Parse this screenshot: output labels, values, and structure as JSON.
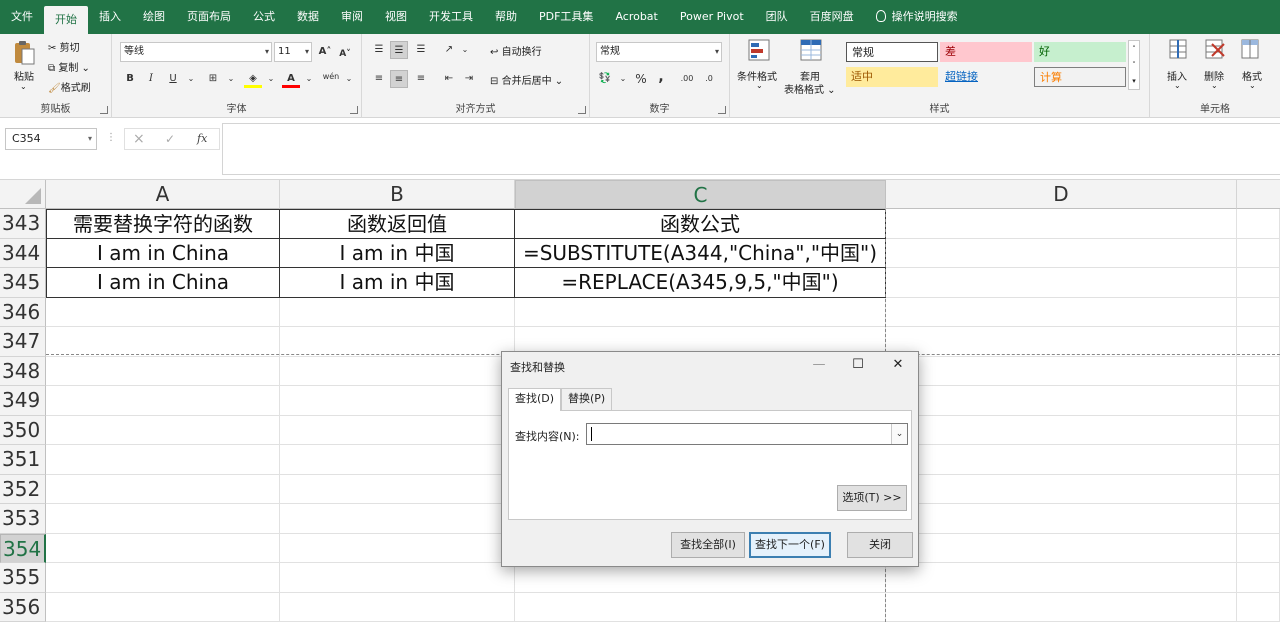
{
  "tabs": [
    "文件",
    "开始",
    "插入",
    "绘图",
    "页面布局",
    "公式",
    "数据",
    "审阅",
    "视图",
    "开发工具",
    "帮助",
    "PDF工具集",
    "Acrobat",
    "Power Pivot",
    "团队",
    "百度网盘"
  ],
  "active_tab": "开始",
  "tell_me": "操作说明搜索",
  "ribbon": {
    "clipboard": {
      "paste": "粘贴",
      "cut": "剪切",
      "copy": "复制",
      "format_painter": "格式刷",
      "label": "剪贴板"
    },
    "font": {
      "name": "等线",
      "size": "11",
      "bold": "B",
      "italic": "I",
      "underline": "U",
      "grow": "A",
      "shrink": "A",
      "font_color": "A",
      "phonetic": "wén",
      "label": "字体"
    },
    "alignment": {
      "wrap": "自动换行",
      "merge": "合并后居中",
      "label": "对齐方式"
    },
    "number": {
      "format": "常规",
      "percent": "%",
      "comma": ",",
      "inc_dec": ".00",
      "dec_dec": ".0",
      "label": "数字"
    },
    "styles": {
      "conditional": "条件格式",
      "table": "套用",
      "table2": "表格格式",
      "normal": "常规",
      "bad": "差",
      "good": "好",
      "neutral": "适中",
      "hyperlink": "超链接",
      "calc": "计算",
      "label": "样式"
    },
    "cells": {
      "insert": "插入",
      "delete": "删除",
      "format": "格式",
      "label": "单元格"
    }
  },
  "formula_bar": {
    "name_box": "C354",
    "cancel": "×",
    "enter": "✓",
    "fx": "fx"
  },
  "columns": [
    "A",
    "B",
    "C",
    "D"
  ],
  "rows": [
    {
      "num": "343",
      "cells": [
        "需要替换字符的函数",
        "函数返回值",
        "函数公式"
      ]
    },
    {
      "num": "344",
      "cells": [
        "I am in China",
        "I am in 中国",
        "=SUBSTITUTE(A344,\"China\",\"中国\")"
      ]
    },
    {
      "num": "345",
      "cells": [
        "I am in China",
        "I am in 中国",
        "=REPLACE(A345,9,5,\"中国\")"
      ]
    },
    {
      "num": "346",
      "cells": [
        "",
        "",
        ""
      ]
    },
    {
      "num": "347",
      "cells": [
        "",
        "",
        ""
      ]
    },
    {
      "num": "348",
      "cells": [
        "",
        "",
        ""
      ]
    },
    {
      "num": "349",
      "cells": [
        "",
        "",
        ""
      ]
    },
    {
      "num": "350",
      "cells": [
        "",
        "",
        ""
      ]
    },
    {
      "num": "351",
      "cells": [
        "",
        "",
        ""
      ]
    },
    {
      "num": "352",
      "cells": [
        "",
        "",
        ""
      ]
    },
    {
      "num": "353",
      "cells": [
        "",
        "",
        ""
      ]
    },
    {
      "num": "354",
      "cells": [
        "",
        "",
        ""
      ]
    },
    {
      "num": "355",
      "cells": [
        "",
        "",
        ""
      ]
    },
    {
      "num": "356",
      "cells": [
        "",
        "",
        ""
      ]
    }
  ],
  "selected_row": "354",
  "selected_col": "C",
  "dialog": {
    "title": "查找和替换",
    "minimize": "—",
    "maximize": "☐",
    "close": "✕",
    "tab_find": "查找(D)",
    "tab_replace": "替换(P)",
    "find_label": "查找内容(N):",
    "find_value": "",
    "options": "选项(T) >>",
    "find_all": "查找全部(I)",
    "find_next": "查找下一个(F)",
    "close_btn": "关闭"
  },
  "colors": {
    "brand": "#217346",
    "bad_bg": "#ffc7ce",
    "bad_fg": "#9c0006",
    "good_bg": "#c6efce",
    "good_fg": "#006100",
    "neutral_bg": "#ffeb9c",
    "neutral_fg": "#9c5700",
    "calc_fg": "#fa7d00"
  }
}
